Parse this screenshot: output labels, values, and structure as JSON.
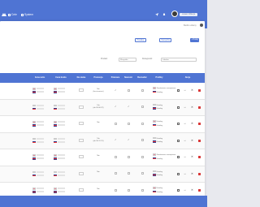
{
  "header": {
    "nav": [
      {
        "label": "Cele",
        "icon": "home-icon"
      },
      {
        "label": "System",
        "icon": "grid-icon"
      }
    ],
    "icons": [
      "send-icon",
      "bell-icon",
      "help-icon"
    ],
    "user_label": "Lukasz Walerja"
  },
  "welcome": "Bardzo witamy",
  "toolbar": {
    "import_label": "Produkty",
    "export_label": "Narzędzia",
    "add_label": "+ Dodaj"
  },
  "filters": [
    {
      "label": "Produkt:",
      "value": "Wszystko"
    },
    {
      "label": "Dostępność:",
      "value": "Lokalne"
    }
  ],
  "table": {
    "headers": [
      "Cena netto",
      "Cena brutto",
      "Na stanie",
      "Promocja",
      "Polecane",
      "Nowości",
      "Bestseller",
      "Profilny",
      "Akcje"
    ],
    "rows": [
      {
        "qty": "",
        "promo": "Nie\n(bez terminu)",
        "profiles": [
          "Zamówienie zewnętrzne",
          "Katalog"
        ]
      },
      {
        "qty": "",
        "promo": "Tak\n(do 30.06.22)",
        "profiles": [
          "Katalog",
          "Katalog"
        ]
      },
      {
        "qty": "",
        "promo": "Nie",
        "profiles": [
          "Katalog",
          "Katalog"
        ]
      },
      {
        "qty": "",
        "promo": "Tak\n(do 30.11.19)",
        "profiles": [
          "Katalog",
          "Katalog"
        ]
      },
      {
        "qty": "",
        "promo": "Nie",
        "profiles": [
          "Zamówienie zewnętrzne",
          "Katalog"
        ]
      },
      {
        "qty": "",
        "promo": "Nie",
        "profiles": [
          "Katalog",
          "Katalog"
        ]
      },
      {
        "qty": "",
        "promo": "Nie",
        "profiles": [
          "Katalog",
          "Katalog"
        ]
      }
    ]
  },
  "colors": {
    "brand": "#4f74d3",
    "danger": "#d93838",
    "background": "#e8e9ee"
  }
}
